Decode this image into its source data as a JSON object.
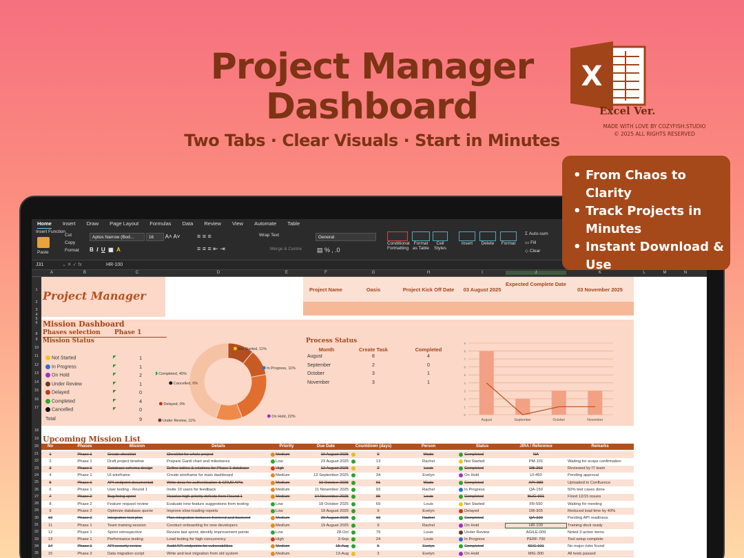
{
  "hero": {
    "title_line1": "Project Manager",
    "title_line2": "Dashboard",
    "subtitle": "Two Tabs · Clear Visuals · Start in Minutes",
    "excel_letter": "X",
    "excel_version": "Excel Ver.",
    "made_by": "MADE WITH LOVE BY COZYFISH.STUDIO",
    "copyright": "© 2025 ALL RIGHTS RESERVED"
  },
  "features": [
    "From Chaos to Clarity",
    "Track Projects in Minutes",
    "Instant Download & Use"
  ],
  "excel": {
    "tabs": [
      "Home",
      "Insert",
      "Draw",
      "Page Layout",
      "Formulas",
      "Data",
      "Review",
      "View",
      "Automate",
      "Table"
    ],
    "ribbon": {
      "insert_function": "Insert Function",
      "paste": "Paste",
      "cut": "Cut",
      "copy": "Copy",
      "format_painter": "Format",
      "font_name": "Aptos Narrow (Bod...",
      "font_size": "16",
      "wrap_text": "Wrap Text",
      "merge_centre": "Merge & Centre",
      "number_format": "General",
      "conditional_formatting": "Conditional Formatting",
      "format_as_table": "Format as Table",
      "cell_styles": "Cell Styles",
      "insert": "Insert",
      "delete": "Delete",
      "format": "Format",
      "autosum": "Auto-sum",
      "fill": "Fill",
      "clear": "Clear"
    },
    "name_box": "J31",
    "formula_value": "HR-100",
    "columns": [
      "A",
      "B",
      "C",
      "D",
      "E",
      "F",
      "G",
      "H",
      "I",
      "J",
      "K",
      "L",
      "M",
      "N"
    ]
  },
  "sheet": {
    "title": "Project Manager",
    "project_name_label": "Project Name",
    "project_name": "Oasis",
    "kickoff_label": "Project Kick Off Date",
    "kickoff_date": "03 August 2025",
    "expected_label": "Expected Complete Date",
    "expected_date": "03 November 2025",
    "mission_dashboard": "Mission Dashboard",
    "phases_selection_label": "Phases selection",
    "phases_selection_value": "Phase 1",
    "mission_status_title": "Mission Status",
    "status_counts": [
      {
        "label": "Not Started",
        "count": "1",
        "color": "#f2c614"
      },
      {
        "label": "In Progress",
        "count": "1",
        "color": "#2a6fd6"
      },
      {
        "label": "On Hold",
        "count": "2",
        "color": "#9b32c8"
      },
      {
        "label": "Under Review",
        "count": "1",
        "color": "#6e3a1e"
      },
      {
        "label": "Delayed",
        "count": "0",
        "color": "#c0391b"
      },
      {
        "label": "Completed",
        "count": "4",
        "color": "#2aa52a"
      },
      {
        "label": "Cancelled",
        "count": "0",
        "color": "#111111"
      }
    ],
    "total_label": "Total",
    "total_count": "9",
    "donut_labels": {
      "cancelled": "Cancelled, 0%",
      "not_started": "Not Started, 11%",
      "in_progress": "In Progress, 11%",
      "completed": "Completed, 45%",
      "delayed": "Delayed, 0%",
      "under_review": "Under Review, 11%",
      "on_hold": "On Hold, 22%"
    },
    "process_status_title": "Process Status",
    "process_headers": [
      "Month",
      "Create Task",
      "Completed"
    ],
    "process_rows": [
      {
        "month": "August",
        "create": "8",
        "completed": "4"
      },
      {
        "month": "September",
        "create": "2",
        "completed": "0"
      },
      {
        "month": "October",
        "create": "3",
        "completed": "1"
      },
      {
        "month": "November",
        "create": "3",
        "completed": "1"
      }
    ],
    "upcoming_title": "Upcoming Mission List",
    "table_headers": [
      "No",
      "Phases",
      "Mission",
      "Details",
      "Priority",
      "Due Date",
      "Countdown (days)",
      "Person",
      "Status",
      "JIRA / Reference",
      "Remarks"
    ],
    "rows": [
      {
        "no": "1",
        "phase": "Phase 1",
        "mission": "Create checklist",
        "details": "Checklist for whole project",
        "priority": "Medium",
        "due": "10 August 2025",
        "countdown": "0",
        "person": "Wade",
        "status": "Completed",
        "ref": "NA",
        "remarks": "",
        "done": true
      },
      {
        "no": "2",
        "phase": "Phase 1",
        "mission": "Draft project timeline",
        "details": "Prepare Gantt chart and milestones",
        "priority": "Low",
        "due": "23 August 2025",
        "countdown": "13",
        "person": "Rachel",
        "status": "Not Started",
        "ref": "PM-101",
        "remarks": "Waiting for scope confirmation",
        "done": false
      },
      {
        "no": "3",
        "phase": "Phase 1",
        "mission": "Database schema design",
        "details": "Define tables & relations for Phase 1 database",
        "priority": "High",
        "due": "12 August 2025",
        "countdown": "2",
        "person": "Louis",
        "status": "Completed",
        "ref": "DB-202",
        "remarks": "Reviewed by IT team",
        "done": true
      },
      {
        "no": "4",
        "phase": "Phase 1",
        "mission": "UI wireframe",
        "details": "Create wireframe for main dashboard",
        "priority": "Medium",
        "due": "13 September 2025",
        "countdown": "34",
        "person": "Evelyn",
        "status": "On Hold",
        "ref": "UI-450",
        "remarks": "Pending approval",
        "done": false
      },
      {
        "no": "5",
        "phase": "Phase 1",
        "mission": "API endpoint documentati",
        "details": "Write docs for authentication & CRUD APIs",
        "priority": "Medium",
        "due": "10 October 2025",
        "countdown": "61",
        "person": "Wade",
        "status": "Completed",
        "ref": "API-089",
        "remarks": "Uploaded to Confluence",
        "done": true
      },
      {
        "no": "6",
        "phase": "Phase 1",
        "mission": "User testing - Round 1",
        "details": "Invite 10 users for feedback",
        "priority": "Medium",
        "due": "11 November 2025",
        "countdown": "93",
        "person": "Rachel",
        "status": "In Progress",
        "ref": "QA-150",
        "remarks": "50% test cases done",
        "done": false
      },
      {
        "no": "7",
        "phase": "Phase 2",
        "mission": "Bug fixing sprint",
        "details": "Resolve high-priority defects from Round 1",
        "priority": "Medium",
        "due": "14 November 2025",
        "countdown": "96",
        "person": "Louis",
        "status": "Completed",
        "ref": "BUG-901",
        "remarks": "Fixed 12/15 issues",
        "done": true
      },
      {
        "no": "8",
        "phase": "Phase 2",
        "mission": "Feature request review",
        "details": "Evaluate new feature suggestions from testing",
        "priority": "Low",
        "due": "18 October 2025",
        "countdown": "69",
        "person": "Louis",
        "status": "Not Started",
        "ref": "FR-550",
        "remarks": "Waiting for meeting",
        "done": false
      },
      {
        "no": "9",
        "phase": "Phase 2",
        "mission": "Optimize database querie",
        "details": "Improve slow-loading reports",
        "priority": "Low",
        "due": "19 August 2025",
        "countdown": "9",
        "person": "Evelyn",
        "status": "Delayed",
        "ref": "DB-305",
        "remarks": "Reduced load time by 40%",
        "done": false
      },
      {
        "no": "10",
        "phase": "Phase 2",
        "mission": "Integration test plan",
        "details": "Plan integration between frontend and backend",
        "priority": "Medium",
        "due": "20 August 2025",
        "countdown": "10",
        "person": "Rachel",
        "status": "Completed",
        "ref": "QA-220",
        "remarks": "Pending API readiness",
        "done": true
      },
      {
        "no": "11",
        "phase": "Phase 1",
        "mission": "Team training session",
        "details": "Conduct onboarding for new developers",
        "priority": "Medium",
        "due": "19 August 2025",
        "countdown": "9",
        "person": "Rachel",
        "status": "On Hold",
        "ref": "HR-100",
        "remarks": "Training deck ready",
        "done": false
      },
      {
        "no": "12",
        "phase": "Phase 1",
        "mission": "Sprint retrospective",
        "details": "Review last sprint, identify improvement points",
        "priority": "Low",
        "due": "28-Oct",
        "countdown": "79",
        "person": "Louis",
        "status": "Under Review",
        "ref": "AGILE-009",
        "remarks": "Noted 3 action items",
        "done": false
      },
      {
        "no": "13",
        "phase": "Phase 1",
        "mission": "Performance testing",
        "details": "Load testing for high concurrency",
        "priority": "High",
        "due": "3-Sep",
        "countdown": "24",
        "person": "Louis",
        "status": "In Progress",
        "ref": "PERF-700",
        "remarks": "Tool setup complete",
        "done": false
      },
      {
        "no": "14",
        "phase": "Phase 1",
        "mission": "API security review",
        "details": "Audit API endpoints for vulnerabilities",
        "priority": "Medium",
        "due": "15-Aug",
        "countdown": "5",
        "person": "Evelyn",
        "status": "Completed",
        "ref": "SEC-101",
        "remarks": "No major risks found",
        "done": true
      },
      {
        "no": "15",
        "phase": "Phase 2",
        "mission": "Data migration script",
        "details": "Write and test migration from old system",
        "priority": "Medium",
        "due": "13-Aug",
        "countdown": "3",
        "person": "Evelyn",
        "status": "On Hold",
        "ref": "MIG-300",
        "remarks": "All tests passed",
        "done": false
      }
    ]
  },
  "colors": {
    "accent": "#a2441a",
    "table_header": "#b5501c",
    "band": "#fbd8c8",
    "priority_low": "#2aa52a",
    "priority_medium": "#e08a1e",
    "priority_high": "#d23a1a"
  },
  "chart_data": [
    {
      "type": "pie",
      "title": "",
      "categories": [
        "Not Started",
        "In Progress",
        "On Hold",
        "Under Review",
        "Delayed",
        "Completed",
        "Cancelled"
      ],
      "values": [
        11,
        11,
        22,
        11,
        0,
        45,
        0
      ],
      "colors": [
        "#b24e1f",
        "#c85b24",
        "#e06e2e",
        "#f08a4a",
        "#f3a77c",
        "#f6c2a4",
        "#fbd8c8"
      ]
    },
    {
      "type": "bar",
      "title": "",
      "categories": [
        "August",
        "September",
        "October",
        "November"
      ],
      "series": [
        {
          "name": "Create Task",
          "values": [
            8,
            2,
            3,
            3
          ]
        },
        {
          "name": "Completed",
          "values": [
            4,
            0,
            1,
            1
          ]
        }
      ],
      "ylim": [
        0,
        9
      ],
      "grid": true
    }
  ]
}
